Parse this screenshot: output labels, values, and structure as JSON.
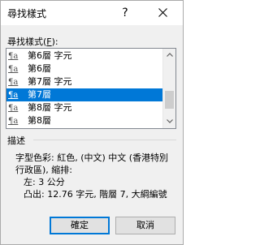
{
  "dialog": {
    "title": "尋找樣式",
    "help_label": "?",
    "close_icon": "close-icon"
  },
  "style_list": {
    "label_prefix": "尋找樣式(",
    "label_accel": "F",
    "label_suffix": "):",
    "icon": "¶a",
    "items": [
      {
        "label": "第6層 字元",
        "selected": false
      },
      {
        "label": "第6層",
        "selected": false
      },
      {
        "label": "第7層 字元",
        "selected": false
      },
      {
        "label": "第7層",
        "selected": true
      },
      {
        "label": "第8層 字元",
        "selected": false
      },
      {
        "label": "第8層",
        "selected": false
      }
    ]
  },
  "description": {
    "label": "描述",
    "line1": "字型色彩: 紅色, (中文) 中文 (香港特別",
    "line2": "行政區), 縮排:",
    "line3": "左:  3 公分",
    "line4": "凸出:  12.76 字元, 階層 7, 大綱編號"
  },
  "buttons": {
    "ok": "確定",
    "cancel": "取消"
  },
  "colors": {
    "selection": "#0078d7",
    "ok_border": "#0078d7"
  }
}
